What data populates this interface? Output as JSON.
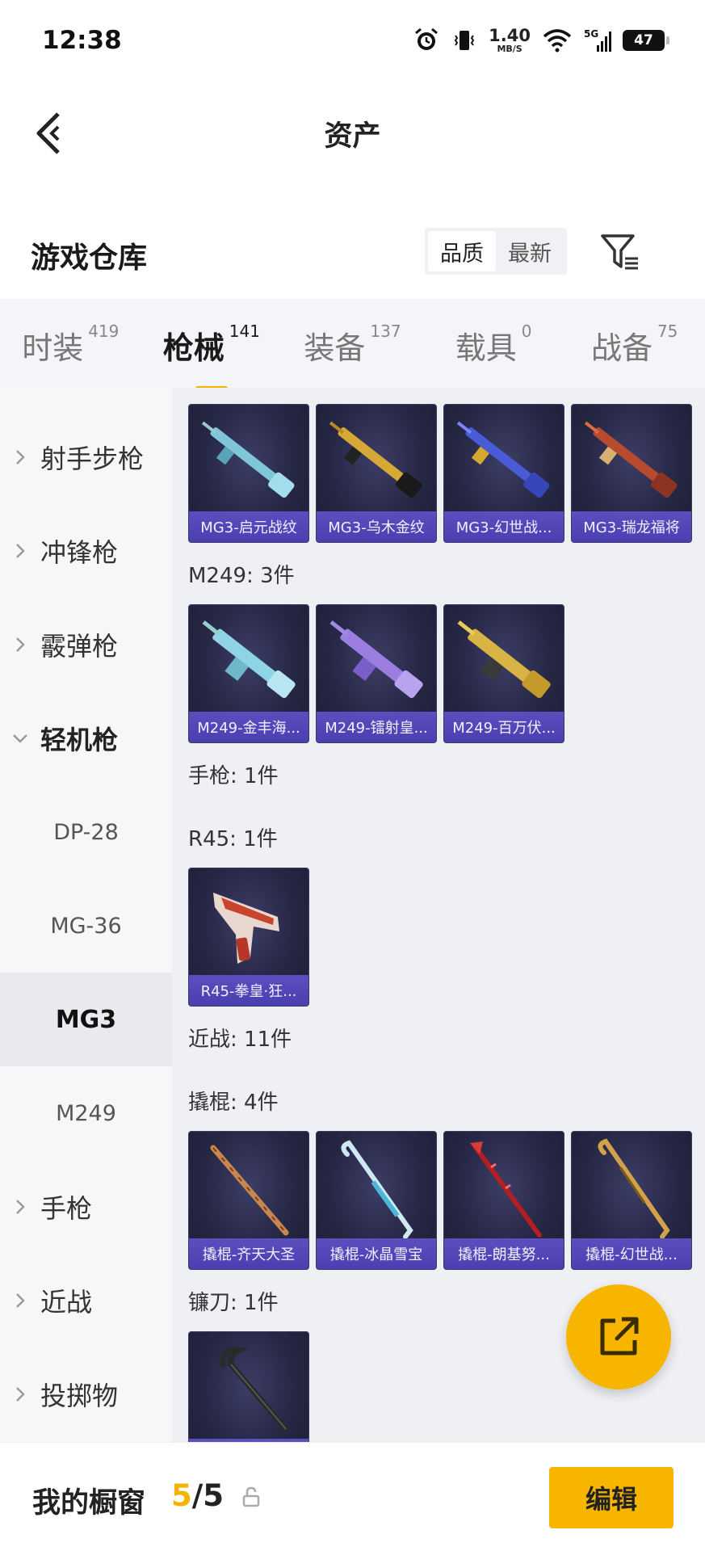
{
  "status_bar": {
    "time": "12:38",
    "net_speed_value": "1.40",
    "net_speed_unit": "MB/S",
    "network_type": "5G",
    "battery": "47"
  },
  "header": {
    "title": "资产"
  },
  "warehouse": {
    "title": "游戏仓库",
    "sort_options": [
      "品质",
      "最新"
    ],
    "active_sort": "品质"
  },
  "tabs": [
    {
      "label": "时装",
      "count": "419"
    },
    {
      "label": "枪械",
      "count": "141",
      "active": true
    },
    {
      "label": "装备",
      "count": "137"
    },
    {
      "label": "载具",
      "count": "0"
    },
    {
      "label": "战备",
      "count": "75"
    }
  ],
  "sidebar": {
    "items": [
      {
        "label": "射手步枪",
        "expandable": true
      },
      {
        "label": "冲锋枪",
        "expandable": true
      },
      {
        "label": "霰弹枪",
        "expandable": true
      },
      {
        "label": "轻机枪",
        "expanded": true
      },
      {
        "label": "DP-28",
        "sub": true
      },
      {
        "label": "MG-36",
        "sub": true
      },
      {
        "label": "MG3",
        "sub": true,
        "selected": true
      },
      {
        "label": "M249",
        "sub": true
      },
      {
        "label": "手枪",
        "expandable": true
      },
      {
        "label": "近战",
        "expandable": true
      },
      {
        "label": "投掷物",
        "expandable": true
      }
    ]
  },
  "content": {
    "mg3_items": [
      "MG3-启元战纹",
      "MG3-乌木金纹",
      "MG3-幻世战...",
      "MG3-瑞龙福将"
    ],
    "m249_label": "M249: 3件",
    "m249_items": [
      "M249-金丰海...",
      "M249-镭射皇...",
      "M249-百万伏..."
    ],
    "pistol_label": "手枪: 1件",
    "r45_label": "R45: 1件",
    "r45_items": [
      "R45-拳皇·狂..."
    ],
    "melee_label": "近战: 11件",
    "crowbar_label": "撬棍: 4件",
    "crowbar_items": [
      "撬棍-齐天大圣",
      "撬棍-冰晶雪宝",
      "撬棍-朗基努...",
      "撬棍-幻世战..."
    ],
    "sickle_label": "镰刀: 1件"
  },
  "colors": {
    "accent": "#f7b500",
    "card_bg": "#262744",
    "card_label_bg": "#4a3fb0"
  },
  "bottom_bar": {
    "label": "我的橱窗",
    "count_current": "5",
    "count_separator": "/",
    "count_total": "5",
    "edit_label": "编辑"
  },
  "icons": {
    "back": "back-arrow-icon",
    "filter": "filter-icon",
    "fab": "share-external-icon",
    "lock": "lock-icon"
  }
}
